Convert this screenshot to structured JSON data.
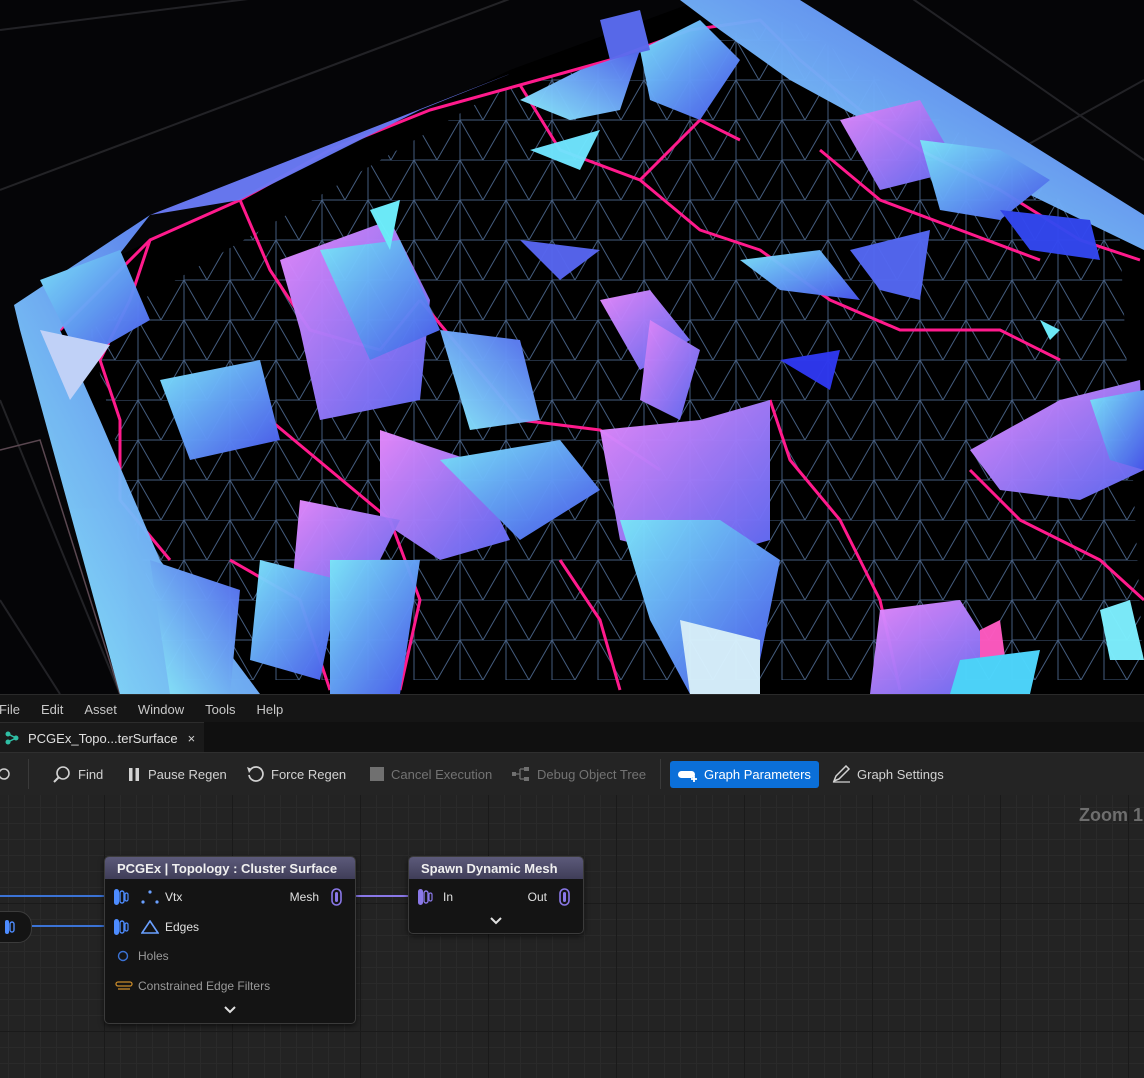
{
  "menubar": {
    "items": [
      {
        "label": "File"
      },
      {
        "label": "Edit"
      },
      {
        "label": "Asset"
      },
      {
        "label": "Window"
      },
      {
        "label": "Tools"
      },
      {
        "label": "Help"
      }
    ]
  },
  "tabs": {
    "active": {
      "label": "PCGEx_Topo...terSurface",
      "close": "×"
    }
  },
  "toolbar": {
    "find": "Find",
    "pause_regen": "Pause Regen",
    "force_regen": "Force Regen",
    "cancel_execution": "Cancel Execution",
    "debug_object_tree": "Debug Object Tree",
    "graph_parameters": "Graph Parameters",
    "graph_settings": "Graph Settings"
  },
  "graph": {
    "zoom_label": "Zoom 1:",
    "nodes": {
      "cluster_surface": {
        "title": "PCGEx | Topology : Cluster Surface",
        "inputs": [
          "Vtx",
          "Edges",
          "Holes",
          "Constrained Edge Filters"
        ],
        "output": "Mesh"
      },
      "spawn_dynamic_mesh": {
        "title": "Spawn Dynamic Mesh",
        "input": "In",
        "output": "Out"
      }
    }
  },
  "colors": {
    "accent_blue": "#0b6fd8",
    "edge_pin": "#4d8cff",
    "mesh_pin": "#8a78e8",
    "surface_magenta": "#ff1a8c",
    "surface_cyan": "#3cd7f0",
    "surface_blue": "#5a6cf0"
  }
}
